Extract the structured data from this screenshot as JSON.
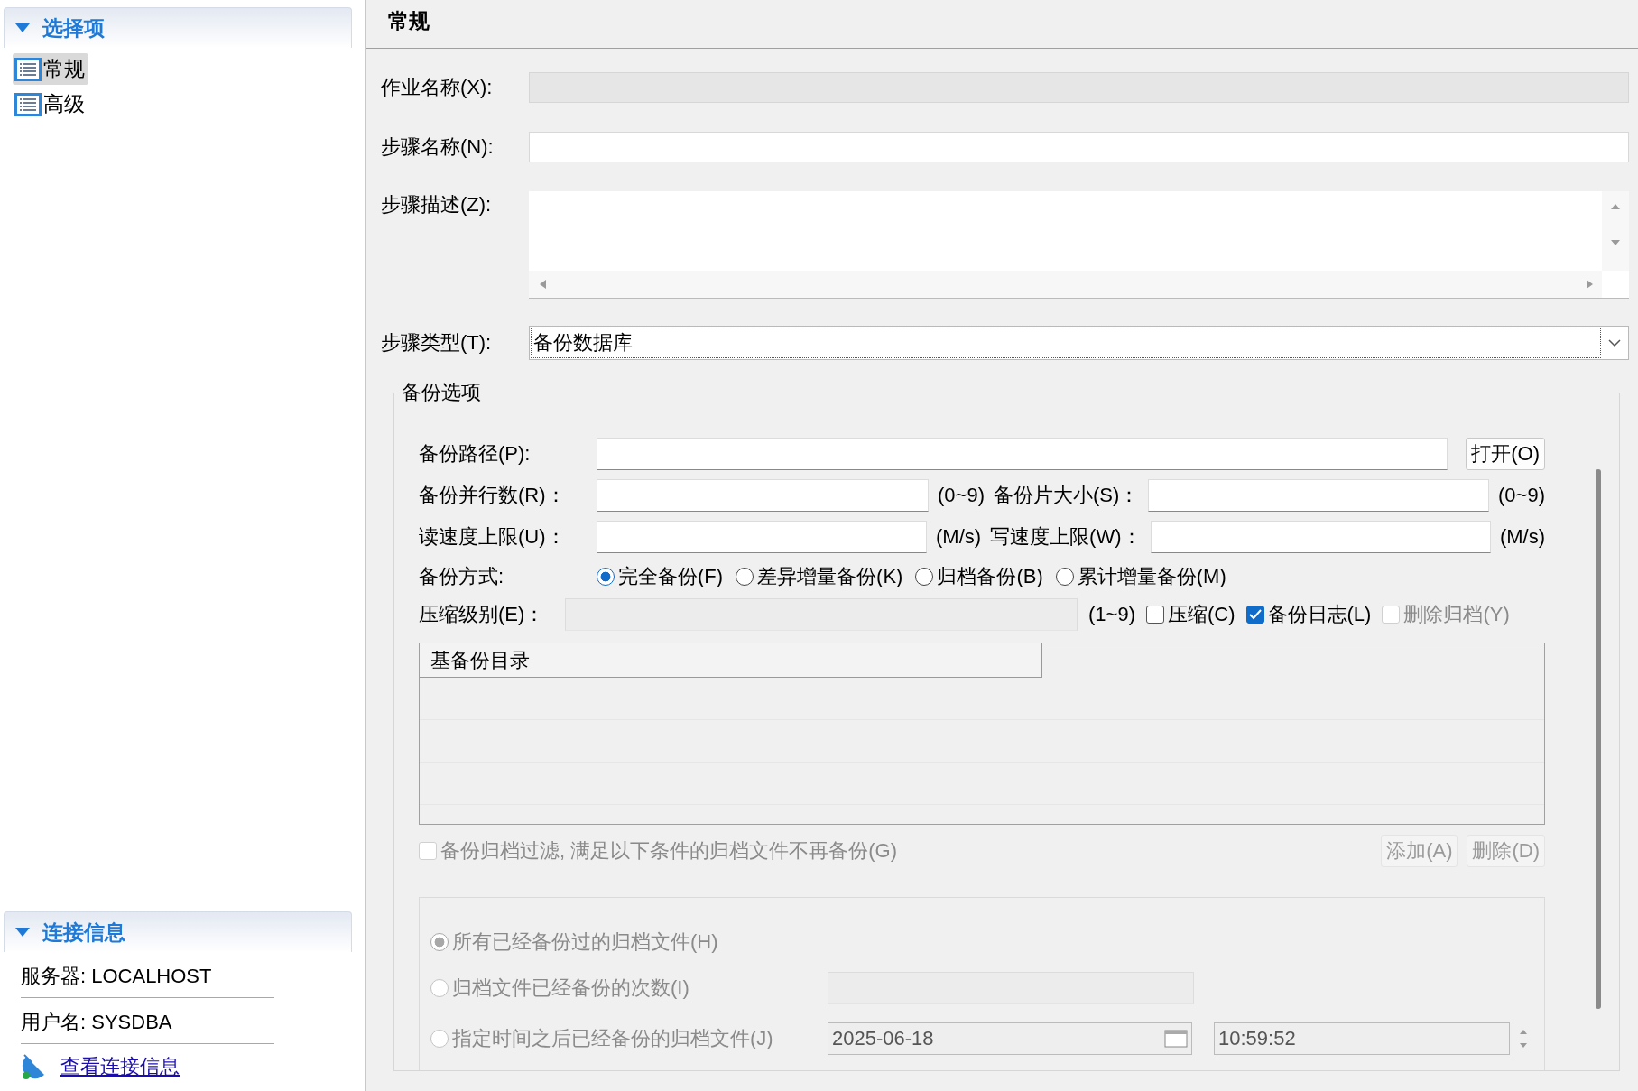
{
  "sidebar": {
    "options_panel": {
      "title": "选择项",
      "expanded": true,
      "items": [
        {
          "label": "常规",
          "selected": true
        },
        {
          "label": "高级",
          "selected": false
        }
      ]
    },
    "connection_panel": {
      "title": "连接信息",
      "expanded": true,
      "rows": [
        "服务器: LOCALHOST",
        "用户名: SYSDBA"
      ],
      "link": "查看连接信息"
    }
  },
  "page_title": "常规",
  "form": {
    "fields": [
      {
        "label": "作业名称(X):",
        "kind": "text",
        "disabled": true
      },
      {
        "label": "步骤名称(N):",
        "kind": "text",
        "disabled": false
      },
      {
        "label": "步骤描述(Z):",
        "kind": "textarea"
      },
      {
        "label": "步骤类型(T):",
        "kind": "select",
        "value": "备份数据库"
      }
    ]
  },
  "backup_options": {
    "title": "备份选项",
    "path": {
      "label": "备份路径(P):",
      "button": "打开(O)"
    },
    "parallel": {
      "label": "备份并行数(R)：",
      "hint": "(0~9)",
      "label2": "备份片大小(S)：",
      "hint2": "(0~9)"
    },
    "speed": {
      "label": "读速度上限(U)：",
      "unit": "(M/s)",
      "label2": "写速度上限(W)：",
      "unit2": "(M/s)"
    },
    "mode": {
      "label": "备份方式:",
      "options": [
        {
          "label": "完全备份(F)",
          "selected": true
        },
        {
          "label": "差异增量备份(K)",
          "selected": false
        },
        {
          "label": "归档备份(B)",
          "selected": false
        },
        {
          "label": "累计增量备份(M)",
          "selected": false
        }
      ]
    },
    "compression": {
      "label": "压缩级别(E)：",
      "disabled": true,
      "hint": "(1~9)",
      "checkboxes": [
        {
          "label": "压缩(C)",
          "checked": false,
          "disabled": false
        },
        {
          "label": "备份日志(L)",
          "checked": true,
          "disabled": false
        },
        {
          "label": "删除归档(Y)",
          "checked": false,
          "disabled": true
        }
      ]
    },
    "table": {
      "columns": [
        "基备份目录"
      ]
    },
    "archive_filter": {
      "label": "备份归档过滤, 满足以下条件的归档文件不再备份(G)",
      "checked": false,
      "disabled": true,
      "buttons": [
        {
          "label": "添加(A)",
          "disabled": true
        },
        {
          "label": "删除(D)",
          "disabled": true
        }
      ],
      "options": [
        {
          "kind": "plain",
          "label": "所有已经备份过的归档文件(H)",
          "selected": true
        },
        {
          "kind": "count",
          "label": "归档文件已经备份的次数(I)",
          "selected": false
        },
        {
          "kind": "datetime",
          "label": "指定时间之后已经备份的归档文件(J)",
          "selected": false,
          "date": "2025-06-18",
          "time": "10:59:52"
        }
      ]
    }
  }
}
